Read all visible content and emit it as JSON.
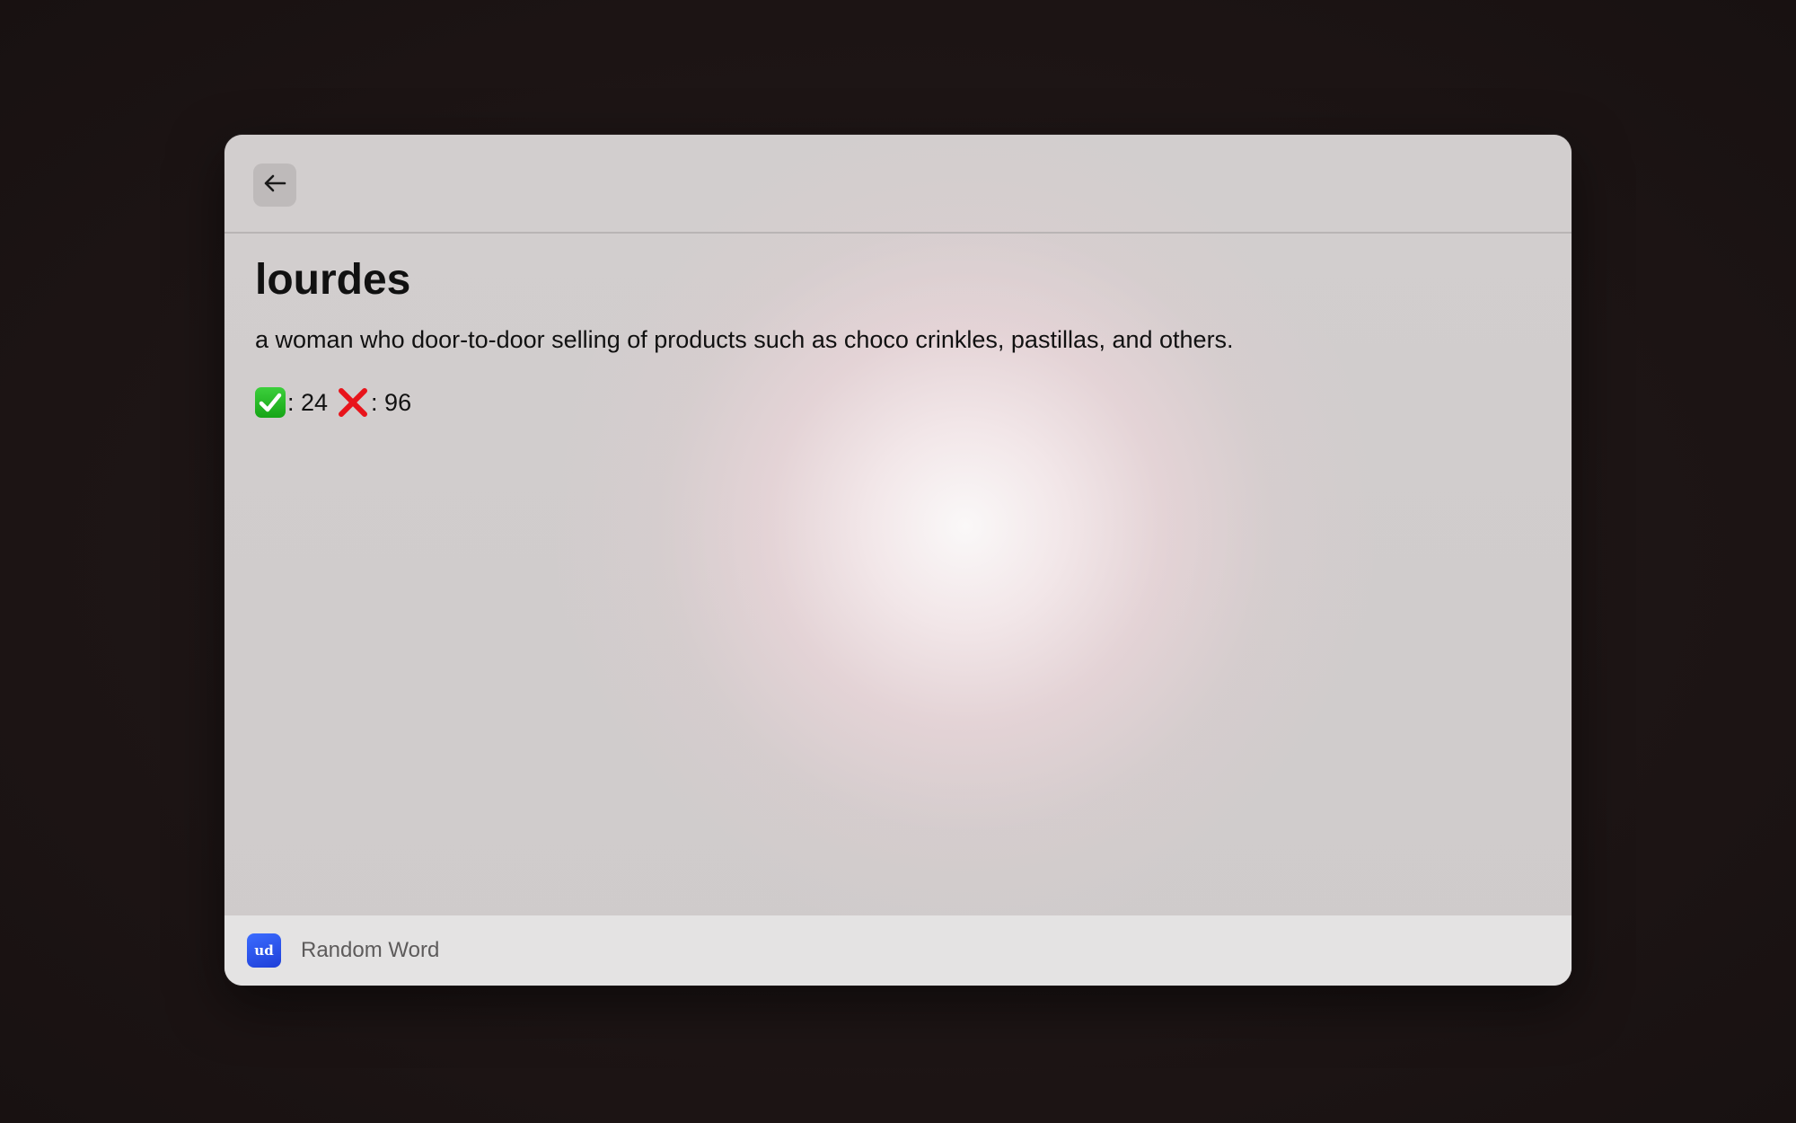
{
  "word": {
    "title": "lourdes",
    "definition": "a woman who door-to-door selling of products such as choco crinkles, pastillas, and others.",
    "thumbs_up_text": ": 24",
    "thumbs_down_text": ": 96"
  },
  "footer": {
    "app_icon_text": "ud",
    "app_name": "Random Word"
  },
  "icons": {
    "back": "arrow-left-icon",
    "upvote": "check-mark-icon",
    "downvote": "cross-mark-icon"
  },
  "colors": {
    "app_icon": "#2f5cf0",
    "check": "#22b522",
    "cross": "#e8141b"
  }
}
